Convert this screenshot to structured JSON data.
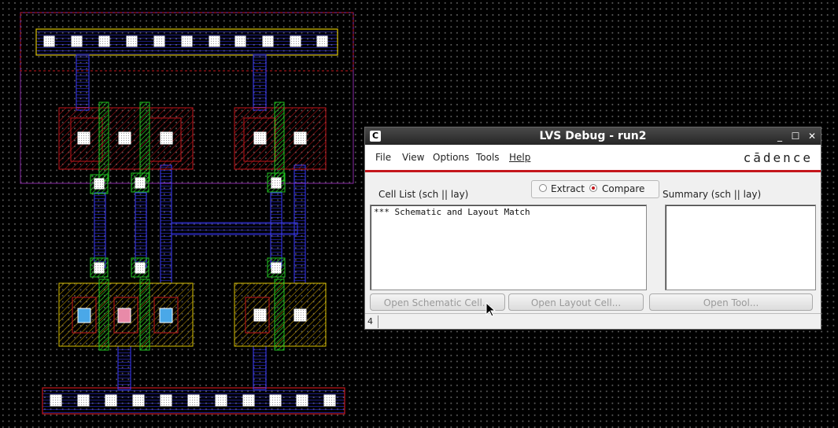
{
  "dialog": {
    "title": "LVS Debug - run2",
    "app_icon": "C",
    "window_buttons": {
      "minimize": "_",
      "maximize": "☐",
      "close": "✕"
    },
    "menus": [
      "File",
      "View",
      "Options",
      "Tools",
      "Help"
    ],
    "brand": "cādence",
    "mode_options": {
      "extract": "Extract",
      "compare": "Compare",
      "selected": "Compare"
    },
    "cell_list_label": "Cell List (sch || lay)",
    "summary_label": "Summary (sch || lay)",
    "cell_list_items": [
      "*** Schematic and Layout Match"
    ],
    "buttons": {
      "open_schematic": "Open Schematic Cell...",
      "open_layout": "Open Layout Cell...",
      "open_tool": "Open Tool..."
    },
    "status_number": "4",
    "accent_color": "#c4161c"
  },
  "layout_canvas": {
    "background": "#000000",
    "layer_colors": {
      "metal1": "#3a3aff",
      "poly": "#1fa21f",
      "oxide": "#b0185b",
      "implant": "#d8c000",
      "nwell": "#8a2aa8",
      "contact": "#ffffff",
      "via": "#20b020"
    }
  }
}
